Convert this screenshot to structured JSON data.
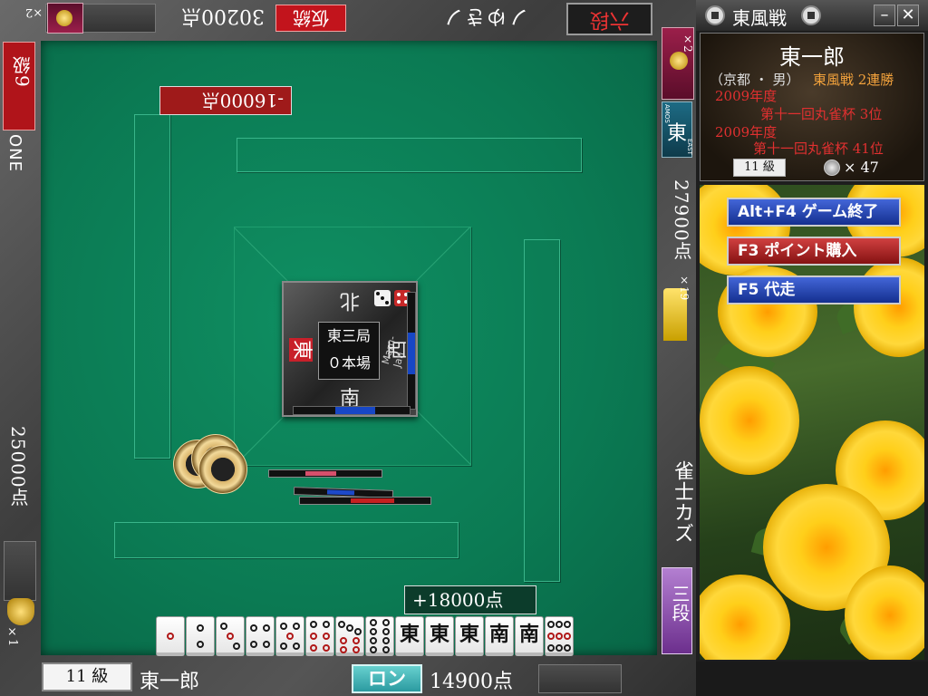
{
  "window": {
    "title": "東風戦",
    "minimize": "–",
    "close": "✕"
  },
  "table": {
    "round": "東三局",
    "honba": "０本場",
    "winds": {
      "north": "北",
      "east": "東",
      "west": "西",
      "south": "南"
    },
    "console_brand": "Maru-Jan"
  },
  "players": {
    "top": {
      "name": "ノゆきノ",
      "rank": "六段",
      "score": "30200点",
      "rank_tag": "仮統"
    },
    "left": {
      "name": "ONE",
      "rank": "6級",
      "score": "25000点"
    },
    "right": {
      "name": "雀士カズ",
      "rank": "三段",
      "score": "27900点",
      "seat": "東",
      "seat_sub": "EAST",
      "seat_sub2": "AMOS",
      "stack_count": "×19"
    },
    "bottom": {
      "name": "東一郎",
      "rank": "11 級",
      "score": "14900点"
    }
  },
  "score_changes": {
    "top": "-16000点",
    "bottom": "+18000点"
  },
  "badges": {
    "top_left_count": "×2",
    "right_count": "×2",
    "trophy_count": "×1"
  },
  "actions": {
    "ron": "ロン"
  },
  "hand": [
    {
      "type": "pin",
      "label": "1p"
    },
    {
      "type": "pin",
      "label": "2p"
    },
    {
      "type": "pin",
      "label": "3p"
    },
    {
      "type": "pin",
      "label": "4p"
    },
    {
      "type": "pin",
      "label": "5p"
    },
    {
      "type": "pin",
      "label": "6p"
    },
    {
      "type": "pin",
      "label": "7p"
    },
    {
      "type": "pin",
      "label": "8p"
    },
    {
      "type": "honor",
      "label": "東"
    },
    {
      "type": "honor",
      "label": "東"
    },
    {
      "type": "honor",
      "label": "東"
    },
    {
      "type": "honor",
      "label": "南"
    },
    {
      "type": "honor",
      "label": "南"
    },
    {
      "type": "pin",
      "label": "9p"
    }
  ],
  "profile": {
    "name": "東一郎",
    "origin": "（京都 ・ 男）",
    "streak": "東風戦 2連勝",
    "history": [
      {
        "year": "2009年度",
        "event": "第十一回丸雀杯 3位"
      },
      {
        "year": "2009年度",
        "event": "第十一回丸雀杯 41位"
      }
    ],
    "rank": "11 級",
    "coins": "× 47"
  },
  "menu": [
    {
      "label": "Alt+F4 ゲーム終了",
      "style": "blue"
    },
    {
      "label": "F3 ポイント購入",
      "style": "red"
    },
    {
      "label": "F5      代走",
      "style": "blue"
    }
  ],
  "colors": {
    "felt": "#0b7a53",
    "rank_red": "#c2141c",
    "ron_teal": "#2b9aa0",
    "menu_blue": "#142f8f",
    "menu_red": "#851212"
  }
}
